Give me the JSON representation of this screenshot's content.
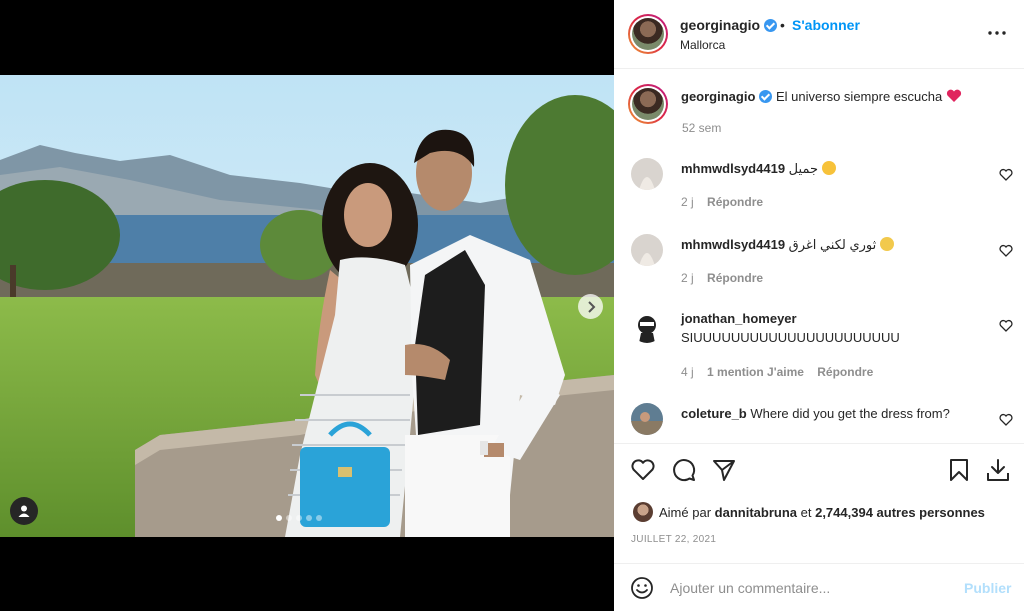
{
  "post": {
    "username": "georginagio",
    "follow_label": "S'abonner",
    "separator": "•",
    "location": "Mallorca",
    "caption": "El universo siempre escucha",
    "caption_emoji": "red-heart",
    "caption_time": "52 sem"
  },
  "comments": [
    {
      "user": "mhmwdlsyd4419",
      "text": "جميل",
      "emoji": "heart-eyes-emoji",
      "time": "2 j",
      "likes": "",
      "reply": "Répondre"
    },
    {
      "user": "mhmwdlsyd4419",
      "text": "ثوري لكني اغرق",
      "emoji": "relieved-emoji",
      "time": "2 j",
      "likes": "",
      "reply": "Répondre"
    },
    {
      "user": "jonathan_homeyer",
      "text": "SIUUUUUUUUUUUUUUUUUUUUUU",
      "emoji": "",
      "time": "4 j",
      "likes": "1 mention J'aime",
      "reply": "Répondre"
    },
    {
      "user": "coleture_b",
      "text": "Where did you get the dress from?",
      "emoji": "",
      "time": "",
      "likes": "",
      "reply": ""
    }
  ],
  "likes": {
    "prefix": "Aimé par",
    "user": "dannitabruna",
    "joiner": "et",
    "others": "2,744,394 autres personnes"
  },
  "date": "JUILLET 22, 2021",
  "add_comment": {
    "placeholder": "Ajouter un commentaire...",
    "publish_label": "Publier"
  },
  "carousel": {
    "total": 5,
    "active_index": 0
  },
  "colors": {
    "accent": "#0095f6",
    "text": "#262626",
    "muted": "#8e8e8e",
    "publish_disabled": "#b2dffc"
  }
}
